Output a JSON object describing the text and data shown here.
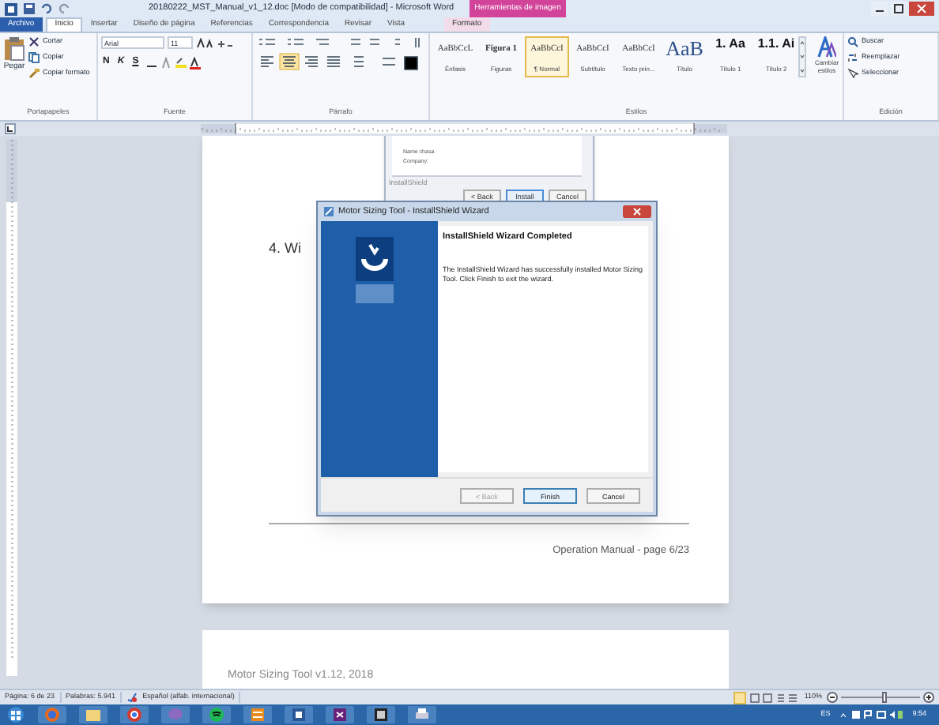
{
  "window": {
    "title": "20180222_MST_Manual_v1_12.doc [Modo de compatibilidad] - Microsoft Word",
    "contextual_group": "Herramientas de imagen"
  },
  "ribbon_tabs": [
    {
      "label": "Archivo",
      "kind": "file",
      "selected": false
    },
    {
      "label": "Inicio",
      "kind": "normal",
      "selected": true
    },
    {
      "label": "Insertar",
      "kind": "normal",
      "selected": false
    },
    {
      "label": "Diseño de página",
      "kind": "normal",
      "selected": false
    },
    {
      "label": "Referencias",
      "kind": "normal",
      "selected": false
    },
    {
      "label": "Correspondencia",
      "kind": "normal",
      "selected": false
    },
    {
      "label": "Revisar",
      "kind": "normal",
      "selected": false
    },
    {
      "label": "Vista",
      "kind": "normal",
      "selected": false
    },
    {
      "label": "Formato",
      "kind": "contextual",
      "selected": false
    }
  ],
  "clipboard": {
    "paste": "Pegar",
    "items": [
      "Cortar",
      "Copiar",
      "Copiar formato"
    ],
    "group_label": "Portapapeles"
  },
  "font": {
    "name": "Arial",
    "size": "11",
    "format_buttons": [
      "N",
      "K",
      "S"
    ],
    "group_label": "Fuente"
  },
  "paragraph": {
    "group_label": "Párrafo"
  },
  "styles": {
    "group_label": "Estilos",
    "change_styles": "Cambiar estilos",
    "items": [
      {
        "preview": "AaBbCcL",
        "label": "Énfasis",
        "selected": false
      },
      {
        "preview": "Figura 1",
        "label": "Figuras",
        "selected": false
      },
      {
        "preview": "AaBbCcI",
        "label": "¶ Normal",
        "selected": true
      },
      {
        "preview": "AaBbCcI",
        "label": "Subtítulo",
        "selected": false
      },
      {
        "preview": "AaBbCcI",
        "label": "Texto prin...",
        "selected": false
      },
      {
        "preview": "AaB",
        "label": "Título",
        "selected": false
      },
      {
        "preview": "1. Aa",
        "label": "Título 1",
        "selected": false
      },
      {
        "preview": "1.1. Ai",
        "label": "Título 2",
        "selected": false
      }
    ]
  },
  "editing": {
    "group_label": "Edición",
    "items": [
      "Buscar",
      "Reemplazar",
      "Seleccionar"
    ]
  },
  "document": {
    "heading": "4. Wi",
    "footer": "Operation Manual - page 6/23",
    "next_page_header": "Motor Sizing Tool v1.12, 2018",
    "background_dialog": {
      "lines": [
        "Name chasa",
        "Company:"
      ],
      "brand": "InstallShield",
      "buttons": [
        {
          "label": "< Back",
          "disabled": false,
          "selected": false
        },
        {
          "label": "Install",
          "disabled": false,
          "selected": true
        },
        {
          "label": "Cancel",
          "disabled": false,
          "selected": false
        }
      ]
    },
    "wizard": {
      "title": "Motor Sizing Tool - InstallShield Wizard",
      "heading": "InstallShield Wizard Completed",
      "message": "The InstallShield Wizard has successfully installed Motor Sizing Tool. Click Finish to exit the wizard.",
      "buttons": [
        {
          "label": "< Back",
          "disabled": true,
          "selected": false
        },
        {
          "label": "Finish",
          "disabled": false,
          "selected": true
        },
        {
          "label": "Cancel",
          "disabled": false,
          "selected": false
        }
      ]
    }
  },
  "status_bar": {
    "page": "Página: 6 de 23",
    "words": "Palabras: 5.941",
    "language": "Español (alfab. internacional)",
    "zoom": "110%",
    "zoom_slider": {
      "level": 0.55
    }
  },
  "taskbar": {
    "language": "ES",
    "time": "9:54"
  }
}
